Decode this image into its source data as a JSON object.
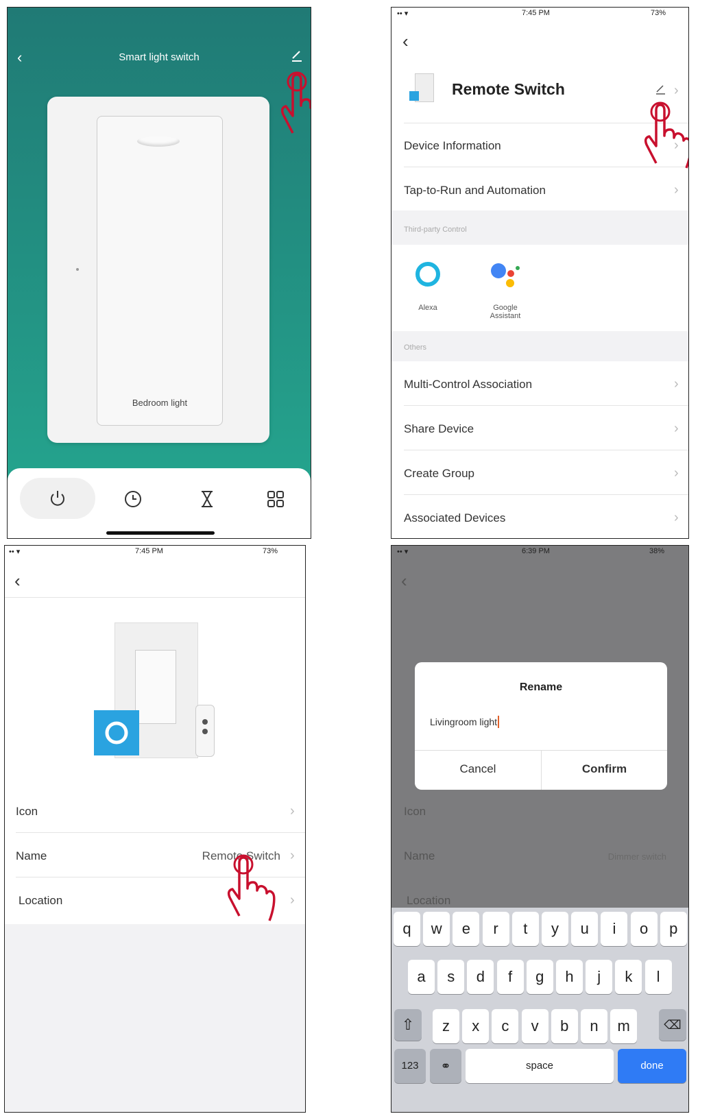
{
  "panel1": {
    "title": "Smart light switch",
    "switch_label": "Bedroom light",
    "tab_icons": [
      "power-icon",
      "clock-icon",
      "hourglass-icon",
      "grid-icon"
    ],
    "colors": {
      "bg_top": "#207a75",
      "bg_bottom": "#25a890"
    }
  },
  "panel2": {
    "status": {
      "time": "7:45 PM",
      "battery": "73%"
    },
    "device_name": "Remote Switch",
    "rows_top": [
      "Device Information",
      "Tap-to-Run and Automation"
    ],
    "section_third_party": "Third-party Control",
    "integrations": [
      {
        "label": "Alexa",
        "icon": "alexa-icon"
      },
      {
        "label": "Google Assistant",
        "icon": "google-assistant-icon"
      }
    ],
    "section_others": "Others",
    "rows_others": [
      "Multi-Control Association",
      "Share Device",
      "Create Group",
      "Associated Devices"
    ]
  },
  "panel3": {
    "status": {
      "time": "7:45 PM",
      "battery": "73%"
    },
    "rows": [
      {
        "label": "Icon",
        "value": ""
      },
      {
        "label": "Name",
        "value": "Remote Switch"
      },
      {
        "label": "Location",
        "value": ""
      }
    ]
  },
  "panel4": {
    "status": {
      "time": "6:39 PM",
      "battery": "38%"
    },
    "dialog": {
      "title": "Rename",
      "input_value": "Livingroom light",
      "cancel_label": "Cancel",
      "confirm_label": "Confirm"
    },
    "bg_rows": [
      {
        "label": "Icon",
        "value": ""
      },
      {
        "label": "Name",
        "value": "Dimmer switch"
      },
      {
        "label": "Location",
        "value": ""
      }
    ],
    "keyboard": {
      "row1": [
        "q",
        "w",
        "e",
        "r",
        "t",
        "y",
        "u",
        "i",
        "o",
        "p"
      ],
      "row2": [
        "a",
        "s",
        "d",
        "f",
        "g",
        "h",
        "j",
        "k",
        "l"
      ],
      "row3": [
        "z",
        "x",
        "c",
        "v",
        "b",
        "n",
        "m"
      ],
      "numbers_label": "123",
      "space_label": "space",
      "done_label": "done"
    }
  }
}
